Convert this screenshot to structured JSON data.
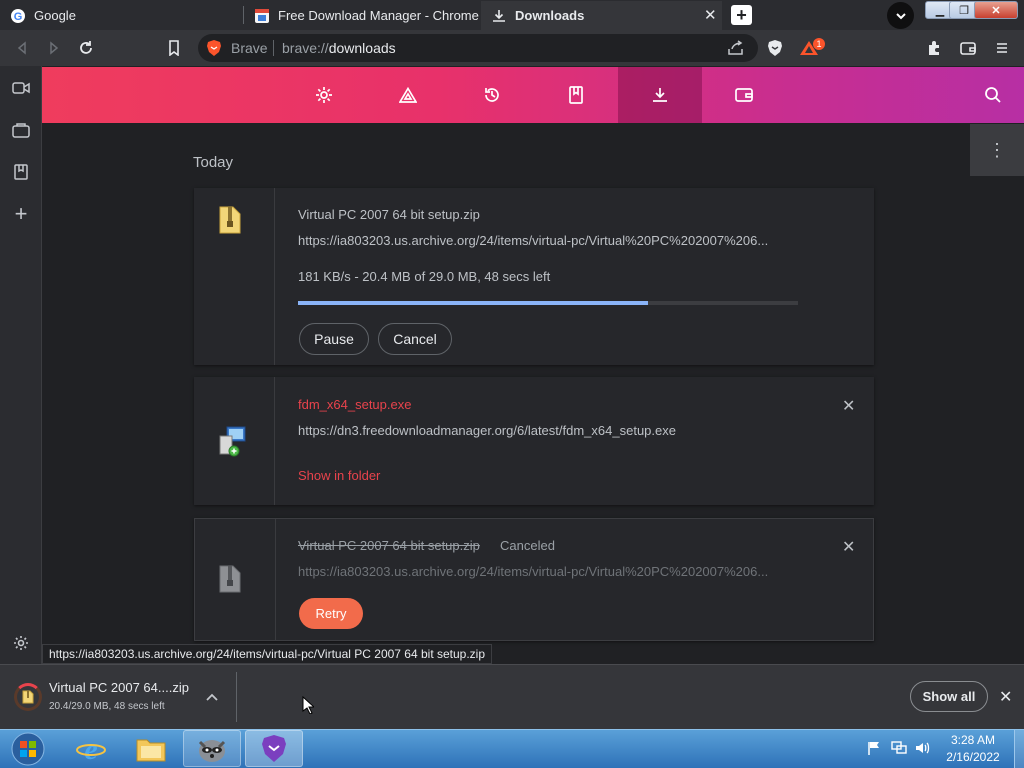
{
  "tabs": [
    {
      "title": "Google",
      "state": "inactive"
    },
    {
      "title": "Free Download Manager - Chrome We",
      "state": "inactive"
    },
    {
      "title": "Downloads",
      "state": "active"
    }
  ],
  "omnibox": {
    "brand": "Brave",
    "scheme": "brave://",
    "path": "downloads",
    "rewards_badge": "1"
  },
  "section_label": "Today",
  "downloads": [
    {
      "filename": "Virtual PC 2007 64 bit setup.zip",
      "url": "https://ia803203.us.archive.org/24/items/virtual-pc/Virtual%20PC%202007%206...",
      "status": "181 KB/s - 20.4 MB of 29.0 MB, 48 secs left",
      "progress": 0.7,
      "buttons": [
        "Pause",
        "Cancel"
      ]
    },
    {
      "filename": "fdm_x64_setup.exe",
      "url": "https://dn3.freedownloadmanager.org/6/latest/fdm_x64_setup.exe",
      "action": "Show in folder"
    },
    {
      "filename": "Virtual PC 2007 64 bit setup.zip",
      "state": "Canceled",
      "url": "https://ia803203.us.archive.org/24/items/virtual-pc/Virtual%20PC%202007%206...",
      "action": "Retry"
    }
  ],
  "status_url": "https://ia803203.us.archive.org/24/items/virtual-pc/Virtual PC 2007 64 bit setup.zip",
  "shelf": {
    "item_name": "Virtual PC 2007 64....zip",
    "item_status": "20.4/29.0 MB, 48 secs left",
    "show_all": "Show all"
  },
  "taskbar": {
    "time": "3:28 AM",
    "date": "2/16/2022"
  },
  "colors": {
    "accent_red": "#e8434c",
    "retry": "#f26b4b",
    "progress": "#8ab4f8"
  },
  "icons": [
    "google-icon",
    "fdm-icon",
    "download-icon",
    "brave-lion-icon",
    "share-icon",
    "brave-shields-icon",
    "rewards-icon",
    "extensions-icon",
    "wallet-icon",
    "menu-icon",
    "settings-icon",
    "warning-icon",
    "history-icon",
    "bookmarks-icon",
    "search-icon"
  ]
}
